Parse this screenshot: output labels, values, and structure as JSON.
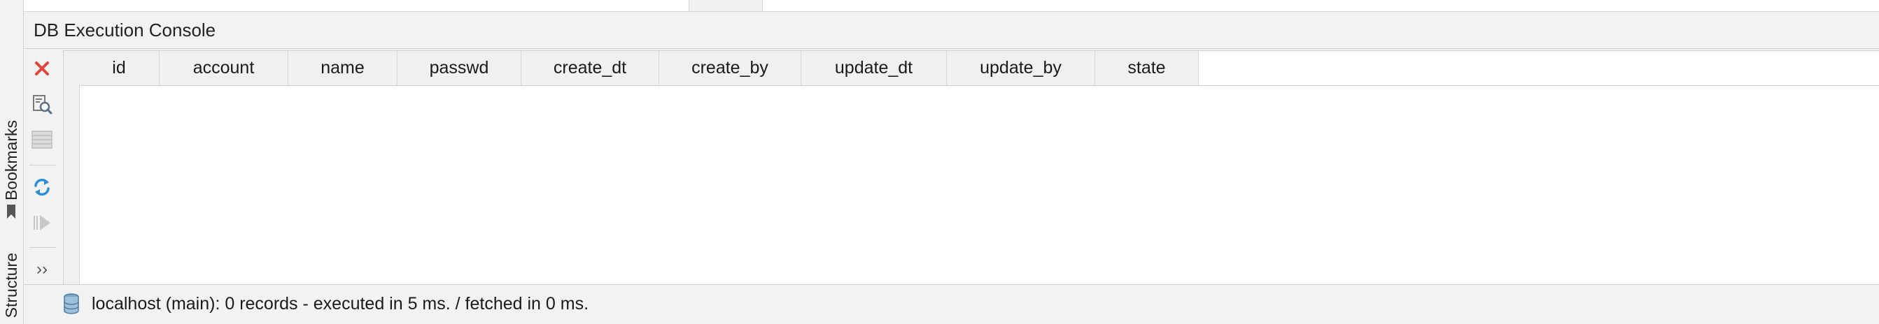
{
  "sidebar": {
    "tabs": [
      {
        "label": "Bookmarks"
      },
      {
        "label": "Structure"
      }
    ]
  },
  "console": {
    "title": "DB Execution Console",
    "toolbar": {
      "items": [
        {
          "name": "close",
          "icon": "close-icon",
          "color": "#e0443c"
        },
        {
          "name": "view-query",
          "icon": "document-search-icon"
        },
        {
          "name": "record-view",
          "icon": "table-rows-icon"
        },
        {
          "name": "refresh",
          "icon": "refresh-icon",
          "color": "#2f8fd6"
        },
        {
          "name": "execute",
          "icon": "play-icon"
        },
        {
          "name": "more",
          "icon": "chevron-double-right-icon",
          "label": "››"
        }
      ]
    }
  },
  "grid": {
    "columns": [
      "id",
      "account",
      "name",
      "passwd",
      "create_dt",
      "create_by",
      "update_dt",
      "update_by",
      "state"
    ],
    "rows": []
  },
  "status": {
    "icon": "database-icon",
    "text": "localhost (main): 0 records  - executed in 5 ms. / fetched in 0 ms."
  }
}
